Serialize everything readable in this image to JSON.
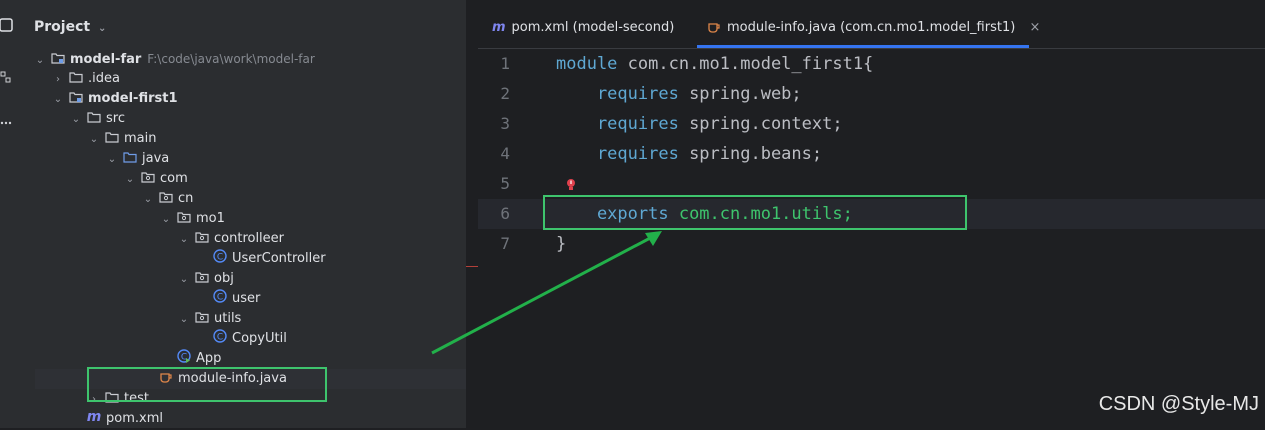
{
  "project_panel": {
    "title": "Project",
    "tree": [
      {
        "label": "model-far",
        "path": "F:\\code\\java\\work\\model-far",
        "bold": true,
        "icon": "module-folder-icon",
        "expanded": true
      },
      {
        "label": ".idea",
        "icon": "folder-icon",
        "expanded": false
      },
      {
        "label": "model-first1",
        "bold": true,
        "icon": "module-folder-icon",
        "expanded": true
      },
      {
        "label": "src",
        "icon": "folder-icon",
        "expanded": true
      },
      {
        "label": "main",
        "icon": "folder-icon",
        "expanded": true
      },
      {
        "label": "java",
        "icon": "source-folder-icon",
        "expanded": true
      },
      {
        "label": "com",
        "icon": "package-icon",
        "expanded": true
      },
      {
        "label": "cn",
        "icon": "package-icon",
        "expanded": true
      },
      {
        "label": "mo1",
        "icon": "package-icon",
        "expanded": true
      },
      {
        "label": "controlleer",
        "icon": "package-icon",
        "expanded": true
      },
      {
        "label": "UserController",
        "icon": "class-icon"
      },
      {
        "label": "obj",
        "icon": "package-icon",
        "expanded": true
      },
      {
        "label": "user",
        "icon": "class-icon"
      },
      {
        "label": "utils",
        "icon": "package-icon",
        "expanded": true
      },
      {
        "label": "CopyUtil",
        "icon": "class-icon"
      },
      {
        "label": "App",
        "icon": "main-class-icon"
      },
      {
        "label": "module-info.java",
        "icon": "java-file-icon"
      },
      {
        "label": "test",
        "icon": "folder-icon",
        "expanded": false
      },
      {
        "label": "pom.xml",
        "icon": "maven-icon"
      }
    ]
  },
  "tabs": [
    {
      "label": "pom.xml (model-second)",
      "icon": "maven-icon",
      "active": false
    },
    {
      "label": "module-info.java (com.cn.mo1.model_first1)",
      "icon": "java-file-icon",
      "active": true,
      "close": "×"
    }
  ],
  "editor": {
    "lines": [
      {
        "num": "1",
        "kw": "module",
        "rest": " com.cn.mo1.model_first1{"
      },
      {
        "num": "2",
        "kw": "    requires",
        "rest": " spring.web;"
      },
      {
        "num": "3",
        "kw": "    requires",
        "rest": " spring.context;"
      },
      {
        "num": "4",
        "kw": "    requires",
        "rest": " spring.beans;"
      },
      {
        "num": "5",
        "kw": "",
        "rest": ""
      },
      {
        "num": "6",
        "kw": "    exports",
        "rest": " com.cn.mo1.utils;"
      },
      {
        "num": "7",
        "kw": "",
        "rest": "}"
      }
    ]
  },
  "watermark": "CSDN @Style-MJ",
  "colors": {
    "keyword": "#5fa8d3",
    "highlight": "#3ec46d",
    "arrow": "#22b04a",
    "bulb": "#e0414d"
  }
}
